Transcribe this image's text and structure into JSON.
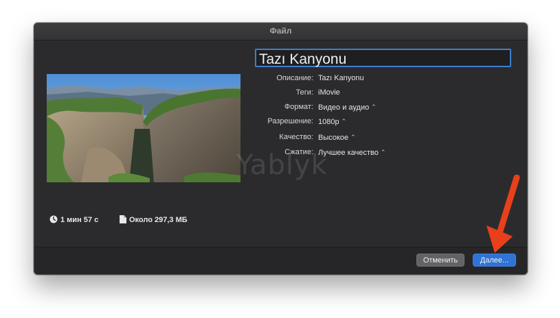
{
  "window": {
    "title": "Файл"
  },
  "project": {
    "name": "Tazı Kanyonu"
  },
  "properties": [
    {
      "label": "Описание:",
      "value": "Tazı Kanyonu",
      "has_popup": false
    },
    {
      "label": "Теги:",
      "value": "iMovie",
      "has_popup": false
    },
    {
      "label": "Формат:",
      "value": "Видео и аудио",
      "has_popup": true
    },
    {
      "label": "Разрешение:",
      "value": "1080p",
      "has_popup": true
    },
    {
      "label": "Качество:",
      "value": "Высокое",
      "has_popup": true
    },
    {
      "label": "Сжатие:",
      "value": "Лучшее качество",
      "has_popup": true
    }
  ],
  "watermark": "Yablyk",
  "meta": {
    "duration": "1 мин 57 с",
    "size": "Около 297,3 МБ"
  },
  "buttons": {
    "cancel": "Отменить",
    "next": "Далее..."
  },
  "icons": {
    "clock": "clock-icon",
    "file": "file-icon",
    "popup": "chevron-updown-icon"
  },
  "colors": {
    "accent": "#2f73d6",
    "arrow": "#e8401c"
  }
}
